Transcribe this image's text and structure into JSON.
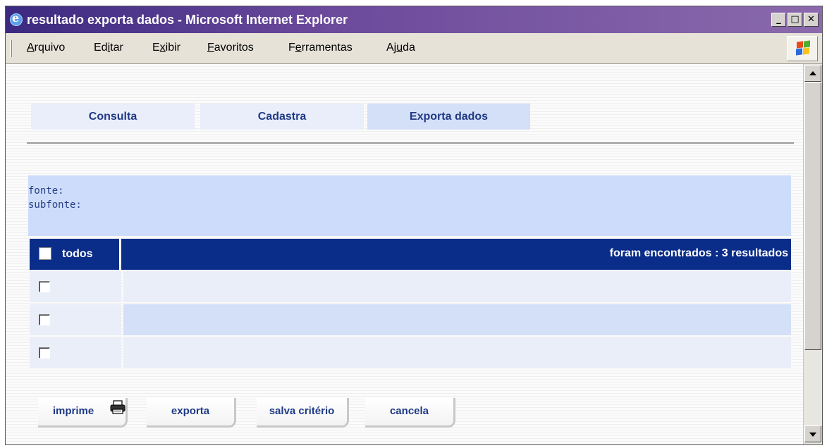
{
  "window": {
    "title": "resultado exporta dados - Microsoft Internet Explorer",
    "min_glyph": "_",
    "max_glyph": "□",
    "close_glyph": "✕"
  },
  "menubar": {
    "items": [
      {
        "label_pre": "",
        "label_ul": "A",
        "label_post": "rquivo"
      },
      {
        "label_pre": "Ed",
        "label_ul": "i",
        "label_post": "tar"
      },
      {
        "label_pre": "E",
        "label_ul": "x",
        "label_post": "ibir"
      },
      {
        "label_pre": "",
        "label_ul": "F",
        "label_post": "avoritos"
      },
      {
        "label_pre": "F",
        "label_ul": "e",
        "label_post": "rramentas"
      },
      {
        "label_pre": "Aj",
        "label_ul": "u",
        "label_post": "da"
      }
    ]
  },
  "tabs": [
    {
      "label": "Consulta",
      "active": false
    },
    {
      "label": "Cadastra",
      "active": false
    },
    {
      "label": "Exporta dados",
      "active": true
    }
  ],
  "source": {
    "fonte_label": "fonte:",
    "subfonte_label": "subfonte:"
  },
  "results": {
    "select_all_label": "todos",
    "summary": "foram encontrados : 3 resultados",
    "rows": [
      {
        "checked": false
      },
      {
        "checked": false
      },
      {
        "checked": false
      }
    ]
  },
  "actions": {
    "imprime": "imprime",
    "exporta": "exporta",
    "salva_criterio": "salva critério",
    "cancela": "cancela"
  },
  "colors": {
    "title_bar": "#3b2a80",
    "tab_text": "#223a84",
    "table_header": "#0a2d8a",
    "source_box": "#cddcfa",
    "row_bg": "#e9eef9",
    "row_alt_bg": "#d4e0f8"
  }
}
